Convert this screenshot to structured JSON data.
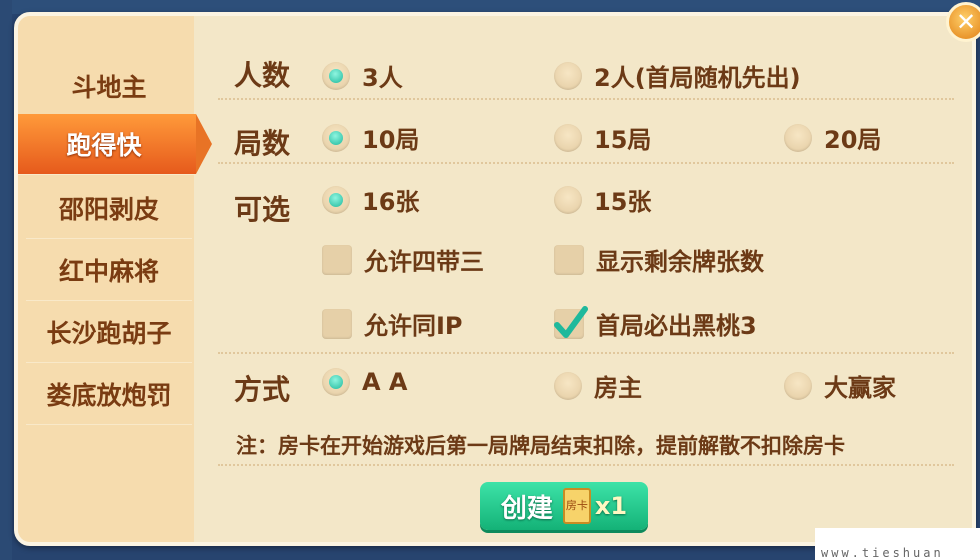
{
  "sidebar": {
    "items": [
      {
        "label": "斗地主"
      },
      {
        "label": "跑得快"
      },
      {
        "label": "邵阳剥皮"
      },
      {
        "label": "红中麻将"
      },
      {
        "label": "长沙跑胡子"
      },
      {
        "label": "娄底放炮罚"
      }
    ],
    "active_index": 1
  },
  "players": {
    "label": "人数",
    "options": [
      {
        "text": "3人",
        "selected": true
      },
      {
        "text": "2人(首局随机先出)",
        "selected": false
      }
    ]
  },
  "rounds": {
    "label": "局数",
    "options": [
      {
        "text": "10局",
        "selected": true
      },
      {
        "text": "15局",
        "selected": false
      },
      {
        "text": "20局",
        "selected": false
      }
    ]
  },
  "optional": {
    "label": "可选",
    "cards_options": [
      {
        "text": "16张",
        "selected": true
      },
      {
        "text": "15张",
        "selected": false
      }
    ],
    "checkboxes": [
      {
        "text": "允许四带三",
        "checked": false
      },
      {
        "text": "显示剩余牌张数",
        "checked": false
      },
      {
        "text": "允许同IP",
        "checked": false
      },
      {
        "text": "首局必出黑桃3",
        "checked": true
      }
    ]
  },
  "payment": {
    "label": "方式",
    "options": [
      {
        "text": "A A",
        "selected": true
      },
      {
        "text": "房主",
        "selected": false
      },
      {
        "text": "大赢家",
        "selected": false
      }
    ]
  },
  "note": "注：房卡在开始游戏后第一局牌局结束扣除，提前解散不扣除房卡",
  "create_button": {
    "label": "创建",
    "card_icon_text": "房卡",
    "count": "x1"
  },
  "watermark": "www.tieshuan",
  "colors": {
    "accent_active": "#e65a1c",
    "radio_on": "#1fb99c",
    "create_button": "#14b277",
    "text_brown": "#6c3a16"
  }
}
